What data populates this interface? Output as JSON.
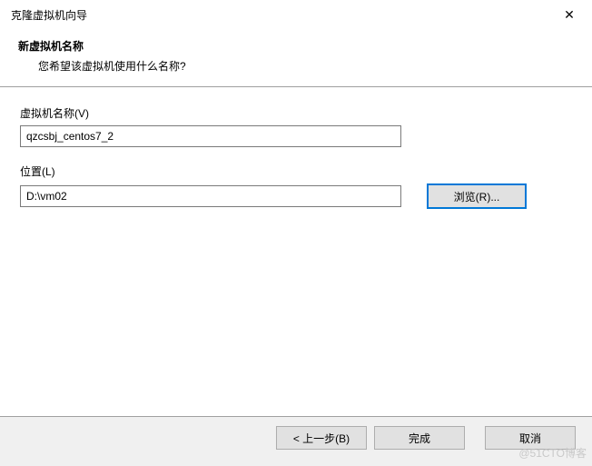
{
  "window": {
    "title": "克隆虚拟机向导"
  },
  "header": {
    "title": "新虚拟机名称",
    "subtitle": "您希望该虚拟机使用什么名称?"
  },
  "fields": {
    "vmName": {
      "label": "虚拟机名称(V)",
      "value": "qzcsbj_centos7_2"
    },
    "location": {
      "label": "位置(L)",
      "value": "D:\\vm02",
      "browseLabel": "浏览(R)..."
    }
  },
  "footer": {
    "back": "< 上一步(B)",
    "finish": "完成",
    "cancel": "取消"
  },
  "watermark": "@51CTO博客"
}
